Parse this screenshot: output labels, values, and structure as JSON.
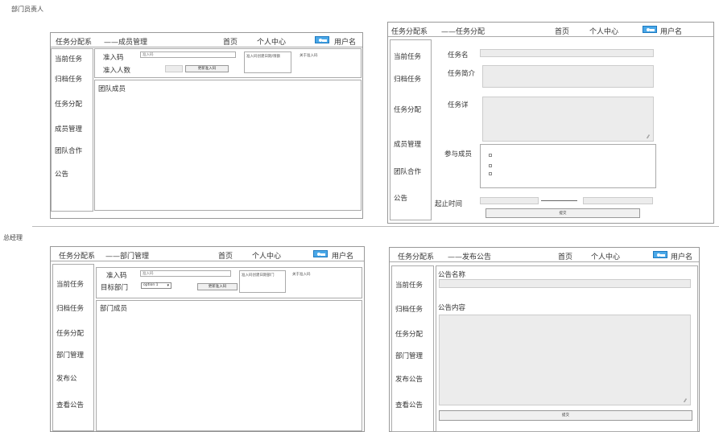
{
  "labels": {
    "dept_head": "部门员责人",
    "general_manager": "总经理"
  },
  "nav": {
    "app_title": "任务分配系",
    "home": "首页",
    "profile": "个人中心",
    "username": "用户名"
  },
  "panel1": {
    "page_title": "——成员管理",
    "sidebar": [
      "当前任务",
      "归档任务",
      "任务分配",
      "成员管理",
      "团队合作",
      "公告"
    ],
    "invite_code_label": "准入码",
    "invite_code_value": "准入码",
    "invite_count_label": "准入人数",
    "update_button": "更新准入码",
    "note_box": "准入码创建日期/限额",
    "share_link": "关于准入码",
    "members_title": "团队成员"
  },
  "panel2": {
    "page_title": "——任务分配",
    "sidebar": [
      "当前任务",
      "归档任务",
      "任务分配",
      "成员管理",
      "团队合作",
      "公告"
    ],
    "task_name_label": "任务名",
    "task_brief_label": "任务简介",
    "task_detail_label": "任务详",
    "participants_label": "参与成员",
    "period_label": "起止时间",
    "submit_button": "提交"
  },
  "panel3": {
    "page_title": "——部门管理",
    "sidebar": [
      "当前任务",
      "归档任务",
      "任务分配",
      "部门管理",
      "发布公",
      "查看公告"
    ],
    "invite_code_label": "准入码",
    "invite_code_value": "准入码",
    "target_dept_label": "目标部门",
    "select_value": "option 1",
    "update_button": "更新准入码",
    "note_box": "准入码创建日期部门",
    "share_link": "关于准入码",
    "members_title": "部门成员"
  },
  "panel4": {
    "page_title": "——发布公告",
    "sidebar": [
      "当前任务",
      "归档任务",
      "任务分配",
      "部门管理",
      "发布公告",
      "查看公告"
    ],
    "notice_name_label": "公告名称",
    "notice_content_label": "公告内容",
    "submit_button": "提交"
  },
  "colors": {
    "avatar_blue": "#4aa8e8",
    "field_gray": "#ececec",
    "border": "#999999"
  }
}
